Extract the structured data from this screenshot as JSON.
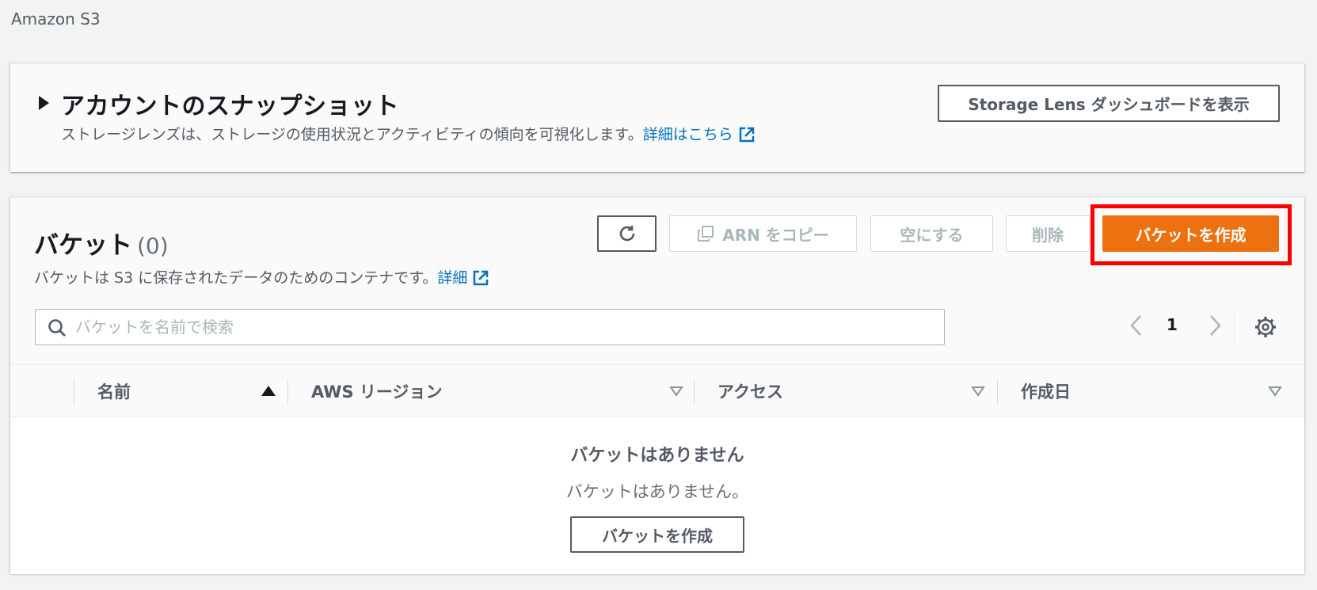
{
  "breadcrumb": "Amazon S3",
  "snapshot": {
    "title": "アカウントのスナップショット",
    "description": "ストレージレンズは、ストレージの使用状況とアクティビティの傾向を可視化します。",
    "link": "詳細はこちら",
    "button": "Storage Lens ダッシュボードを表示"
  },
  "buckets": {
    "title": "バケット",
    "count": "(0)",
    "description": "バケットは S3 に保存されたデータのためのコンテナです。",
    "link": "詳細",
    "actions": {
      "copy_arn": "ARN をコピー",
      "empty": "空にする",
      "delete": "削除",
      "create": "バケットを作成"
    },
    "search_placeholder": "バケットを名前で検索",
    "page": "1",
    "columns": [
      "名前",
      "AWS リージョン",
      "アクセス",
      "作成日"
    ],
    "empty_title": "バケットはありません",
    "empty_desc": "バケットはありません。",
    "empty_button": "バケットを作成"
  },
  "colors": {
    "primary": "#ec7211",
    "link": "#0073bb",
    "highlight": "#ff0000"
  }
}
